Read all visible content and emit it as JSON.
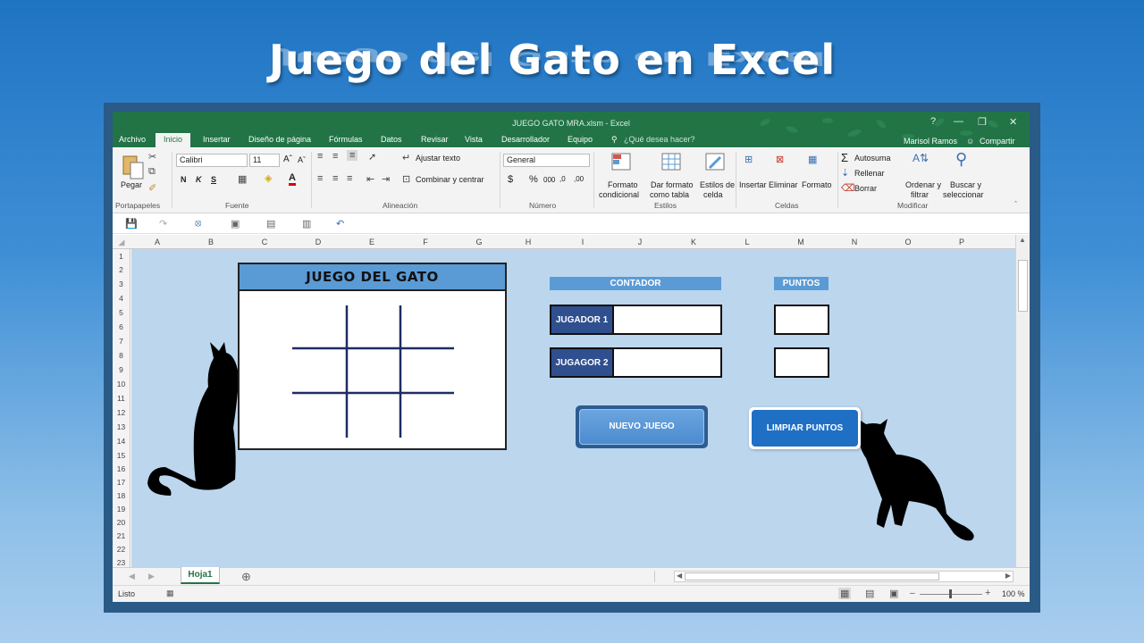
{
  "slide": {
    "title": "Juego del Gato en Excel"
  },
  "window": {
    "document_title": "JUEGO GATO MRA.xlsm - Excel",
    "controls": [
      "?",
      "—",
      "❐",
      "✕"
    ]
  },
  "ribbon": {
    "tabs": [
      "Archivo",
      "Inicio",
      "Insertar",
      "Diseño de página",
      "Fórmulas",
      "Datos",
      "Revisar",
      "Vista",
      "Desarrollador",
      "Equipo"
    ],
    "active_tab": "Inicio",
    "search": "¿Qué desea hacer?",
    "user": "Marisol Ramos",
    "share": "Compartir",
    "clipboard": {
      "paste": "Pegar",
      "label": "Portapapeles"
    },
    "font": {
      "name": "Calibri",
      "size": "11",
      "bold": "N",
      "italic": "K",
      "underline": "S",
      "label": "Fuente"
    },
    "alignment": {
      "wrap": "Ajustar texto",
      "merge": "Combinar y centrar",
      "label": "Alineación"
    },
    "number": {
      "format": "General",
      "currency": "$",
      "percent": "%",
      "thousands": "000",
      "label": "Número"
    },
    "styles": {
      "conditional": [
        "Formato",
        "condicional"
      ],
      "table": [
        "Dar formato",
        "como tabla"
      ],
      "cell": [
        "Estilos de",
        "celda"
      ],
      "label": "Estilos"
    },
    "cells": {
      "insert": "Insertar",
      "delete": "Eliminar",
      "format": "Formato",
      "label": "Celdas"
    },
    "editing": {
      "autosum": "Autosuma",
      "fill": "Rellenar",
      "clear": "Borrar",
      "sort": [
        "Ordenar y",
        "filtrar"
      ],
      "find": [
        "Buscar y",
        "seleccionar"
      ],
      "label": "Modificar"
    }
  },
  "sheet": {
    "columns": [
      "A",
      "B",
      "C",
      "D",
      "E",
      "F",
      "G",
      "H",
      "I",
      "J",
      "K",
      "L",
      "M",
      "N",
      "O",
      "P"
    ],
    "rows": [
      "1",
      "2",
      "3",
      "4",
      "5",
      "6",
      "7",
      "8",
      "9",
      "10",
      "11",
      "12",
      "13",
      "14",
      "15",
      "16",
      "17",
      "18",
      "19",
      "20",
      "21",
      "22",
      "23"
    ]
  },
  "game": {
    "board_title": "JUEGO DEL GATO",
    "counter_label": "CONTADOR",
    "points_label": "PUNTOS",
    "player1": "JUGADOR 1",
    "player2": "JUGAGOR 2",
    "player1_name": "",
    "player2_name": "",
    "player1_points": "",
    "player2_points": "",
    "new_game": "NUEVO JUEGO",
    "clear_points": "LIMPIAR PUNTOS"
  },
  "sheet_tabs": [
    "Hoja1"
  ],
  "status": {
    "ready": "Listo",
    "zoom": "100 %"
  },
  "colors": {
    "excel_green": "#227447",
    "sheet_bg": "#bcd6ee",
    "header_blue": "#5b9bd5",
    "player_label": "#2f4f8f"
  },
  "icons": [
    "save-icon",
    "undo-icon",
    "redo-icon",
    "paste-icon",
    "cut-icon",
    "copy-icon",
    "format-painter-icon",
    "sum-icon",
    "sort-filter-icon",
    "find-icon",
    "cat-silhouette"
  ]
}
